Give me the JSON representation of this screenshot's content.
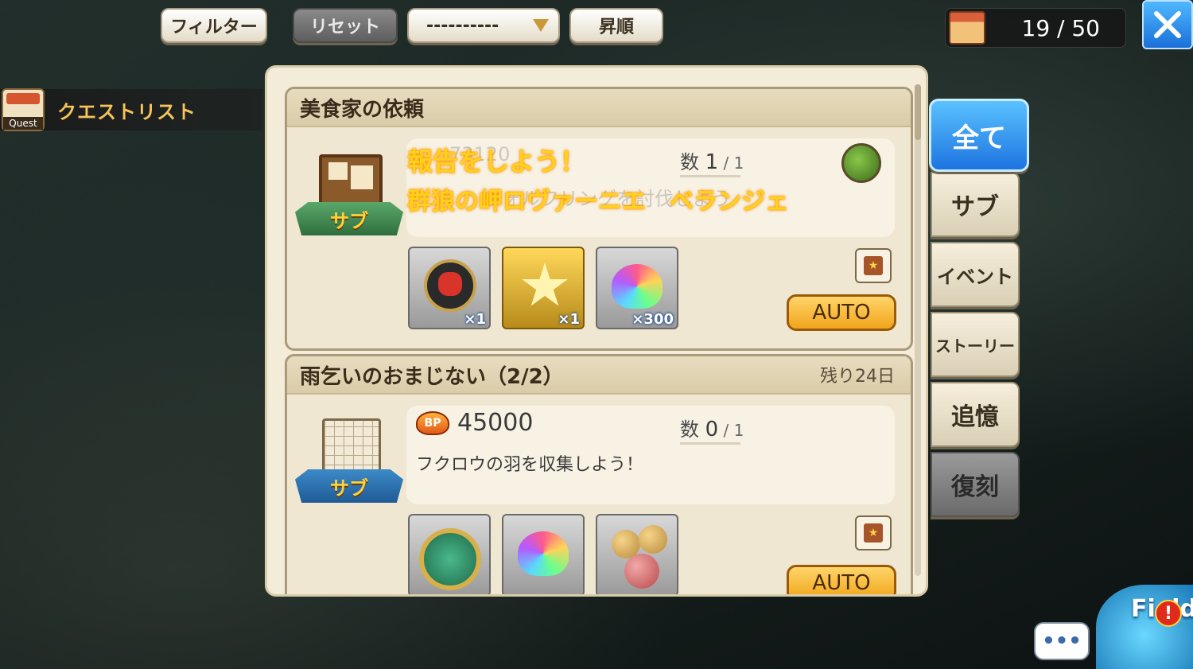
{
  "toolbar": {
    "filter_label": "フィルター",
    "reset_label": "リセット",
    "sort_select_value": "----------",
    "order_label": "昇順"
  },
  "counter": {
    "value": "19 / 50"
  },
  "sidebar": {
    "quest_list_label": "クエストリスト",
    "quest_icon_text": "Quest"
  },
  "quests": [
    {
      "title": "美食家の依頼",
      "remaining": "",
      "bp": "73120",
      "count_current": "1",
      "count_total": "1",
      "description": "ウォルフリングを討伐しよう",
      "badge": "サブ",
      "overlay_line1": "報告をしよう！",
      "overlay_line2": "群狼の岬ロヴァーニエ　ベランジェ",
      "rewards": [
        {
          "name": "emblem",
          "qty": "×1"
        },
        {
          "name": "star",
          "qty": "×1"
        },
        {
          "name": "crystal",
          "qty": "×300"
        }
      ],
      "auto_label": "AUTO"
    },
    {
      "title": "雨乞いのおまじない（2/2）",
      "remaining": "残り24日",
      "bp": "45000",
      "count_current": "0",
      "count_total": "1",
      "description": "フクロウの羽を収集しよう！",
      "badge": "サブ",
      "rewards": [
        {
          "name": "coin",
          "qty": ""
        },
        {
          "name": "crystal",
          "qty": ""
        },
        {
          "name": "balls",
          "qty": ""
        }
      ],
      "auto_label": "AUTO"
    }
  ],
  "bp_icon_text": "BP",
  "count_label": "数",
  "tabs": {
    "all": "全て",
    "sub": "サブ",
    "event": "イベント",
    "story": "ストーリー",
    "memory": "追憶",
    "reprint": "復刻"
  },
  "field": {
    "label": "Field",
    "chat": "•••"
  }
}
